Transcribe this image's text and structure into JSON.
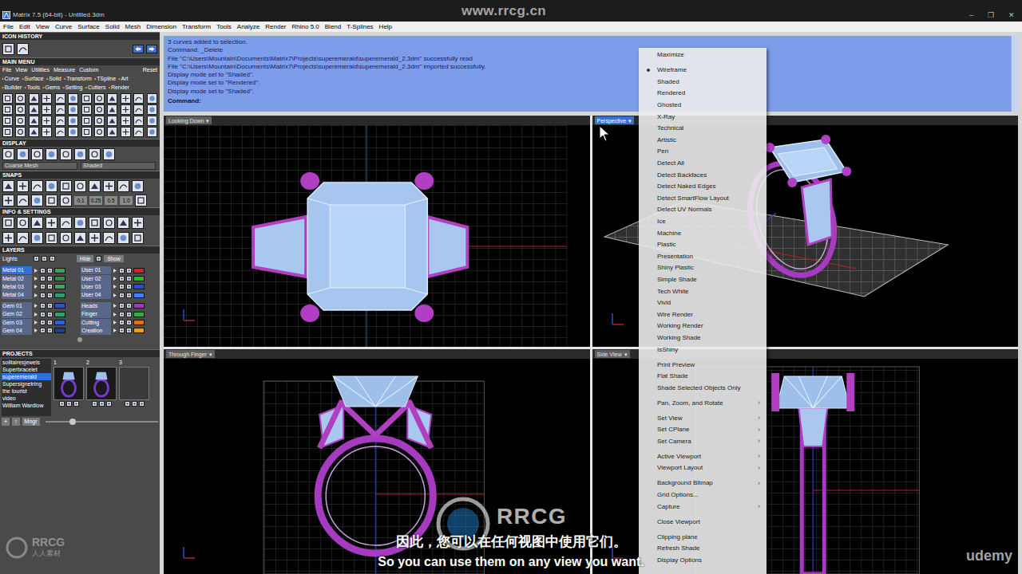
{
  "window": {
    "title": "Matrix 7.5 (64-bit) - Untitled.3dm",
    "controls": [
      "–",
      "❐",
      "✕"
    ]
  },
  "menu_bar": [
    "File",
    "Edit",
    "View",
    "Curve",
    "Surface",
    "Solid",
    "Mesh",
    "Dimension",
    "Transform",
    "Tools",
    "Analyze",
    "Render",
    "Rhino 5.0",
    "Blend",
    "T-Splines",
    "Help"
  ],
  "left_panel": {
    "icon_history": {
      "title": "ICON HISTORY"
    },
    "main_menu": {
      "title": "MAIN MENU",
      "menu": [
        "File",
        "View",
        "Utilities",
        "Measure",
        "Custom"
      ],
      "reset": "Reset",
      "bullet": "•",
      "tabs": [
        {
          "label": "Curve",
          "selected": false
        },
        {
          "label": "Surface",
          "selected": false
        },
        {
          "label": "Solid",
          "selected": false
        },
        {
          "label": "Transform",
          "selected": false
        },
        {
          "label": "TSpline",
          "selected": false
        },
        {
          "label": "Art",
          "selected": false
        },
        {
          "label": "Builder",
          "selected": false
        },
        {
          "label": "Tools",
          "selected": false
        },
        {
          "label": "Gems",
          "selected": false
        },
        {
          "label": "Setting",
          "selected": false
        },
        {
          "label": "Cutters",
          "selected": false
        },
        {
          "label": "Render",
          "selected": false
        }
      ]
    },
    "display": {
      "title": "DISPLAY",
      "mesh": "Coarse Mesh",
      "mode": "Shaded"
    },
    "snaps": {
      "title": "SNAPS",
      "values": [
        "0.1",
        "0.25",
        "0.5",
        "1.0"
      ]
    },
    "info": {
      "title": "INFO & SETTINGS"
    },
    "layers": {
      "title": "LAYERS",
      "lights": "Lights",
      "hide": "Hide",
      "show": "Show",
      "groups": [
        {
          "left": [
            {
              "name": "Metal 01",
              "selected": true,
              "color": "#38a05a"
            },
            {
              "name": "Metal 02",
              "selected": false,
              "color": "#2d8f4e"
            },
            {
              "name": "Metal 03",
              "selected": false,
              "color": "#3aa85f"
            },
            {
              "name": "Metal 04",
              "selected": false,
              "color": "#2f9a7a"
            }
          ],
          "right": [
            {
              "name": "User 01",
              "selected": false,
              "color": "#e02020"
            },
            {
              "name": "User 02",
              "selected": false,
              "color": "#20c020"
            },
            {
              "name": "User 03",
              "selected": false,
              "color": "#2050e0"
            },
            {
              "name": "User 04",
              "selected": false,
              "color": "#4080ff"
            }
          ]
        },
        {
          "left": [
            {
              "name": "Gem 01",
              "selected": false,
              "color": "#3050d0"
            },
            {
              "name": "Gem 02",
              "selected": false,
              "color": "#30a070"
            },
            {
              "name": "Gem 03",
              "selected": false,
              "color": "#3060e0"
            },
            {
              "name": "Gem 04",
              "selected": false,
              "color": "#204080"
            }
          ],
          "right": [
            {
              "name": "Heads",
              "selected": false,
              "color": "#b030c0"
            },
            {
              "name": "Finger",
              "selected": false,
              "color": "#30b040"
            },
            {
              "name": "Cutting",
              "selected": false,
              "color": "#e07020"
            },
            {
              "name": "Creation",
              "selected": false,
              "color": "#e0a020"
            }
          ]
        }
      ]
    },
    "projects": {
      "title": "PROJECTS",
      "items": [
        {
          "label": "solitairesjewels",
          "selected": false
        },
        {
          "label": "Superbracelet",
          "selected": false
        },
        {
          "label": "superemerald",
          "selected": true
        },
        {
          "label": "Supersignetring",
          "selected": false
        },
        {
          "label": "the tourist",
          "selected": false
        },
        {
          "label": "video",
          "selected": false
        },
        {
          "label": "William Wardlow",
          "selected": false
        }
      ],
      "thumbs": [
        {
          "number": "1",
          "has_preview": true
        },
        {
          "number": "2",
          "has_preview": true
        },
        {
          "number": "3",
          "has_preview": false
        }
      ],
      "buttons": [
        "+",
        "↑",
        "Mngr"
      ]
    }
  },
  "command_history": {
    "lines": [
      "3 curves added to selection.",
      "Command: _Delete",
      "File \"C:\\Users\\Mountain\\Documents\\Matrix7\\Projects\\superemerald\\superemerald_2.3dm\" successfully read",
      "File \"C:\\Users\\Mountain\\Documents\\Matrix7\\Projects\\superemerald\\superemerald_2.3dm\" imported successfully.",
      "Display mode set to \"Shaded\".",
      "Display mode set to \"Rendered\".",
      "Display mode set to \"Shaded\"."
    ],
    "prompt": "Command:"
  },
  "viewports": {
    "dropdown_arrow": "▾",
    "items": [
      {
        "label": "Looking Down",
        "active": false
      },
      {
        "label": "Perspective",
        "active": true
      },
      {
        "label": "Through Finger",
        "active": false
      },
      {
        "label": "Side View",
        "active": false
      }
    ]
  },
  "context_menu": {
    "groups": [
      [
        {
          "label": "Maximize",
          "checked": false
        }
      ],
      [
        {
          "label": "Wireframe",
          "checked": true
        },
        {
          "label": "Shaded",
          "checked": false
        },
        {
          "label": "Rendered",
          "checked": false
        },
        {
          "label": "Ghosted",
          "checked": false
        },
        {
          "label": "X-Ray",
          "checked": false
        },
        {
          "label": "Technical",
          "checked": false
        },
        {
          "label": "Artistic",
          "checked": false
        },
        {
          "label": "Pen",
          "checked": false
        },
        {
          "label": "Detect All",
          "checked": false
        },
        {
          "label": "Detect Backfaces",
          "checked": false
        },
        {
          "label": "Detect Naked Edges",
          "checked": false
        },
        {
          "label": "Detect SmartFlow Layout",
          "checked": false
        },
        {
          "label": "Detect UV Normals",
          "checked": false
        },
        {
          "label": "Ice",
          "checked": false
        },
        {
          "label": "Machine",
          "checked": false
        },
        {
          "label": "Plastic",
          "checked": false
        },
        {
          "label": "Presentation",
          "checked": false
        },
        {
          "label": "Shiny Plastic",
          "checked": false
        },
        {
          "label": "Simple Shade",
          "checked": false
        },
        {
          "label": "Tech White",
          "checked": false
        },
        {
          "label": "Vivid",
          "checked": false
        },
        {
          "label": "Wire Render",
          "checked": false
        },
        {
          "label": "Working Render",
          "checked": false
        },
        {
          "label": "Working Shade",
          "checked": false
        },
        {
          "label": "IsShiny",
          "checked": false
        }
      ],
      [
        {
          "label": "Print Preview",
          "checked": false
        },
        {
          "label": "Flat Shade",
          "checked": false
        },
        {
          "label": "Shade Selected Objects Only",
          "checked": false
        }
      ],
      [
        {
          "label": "Pan, Zoom, and Rotate",
          "checked": false,
          "arrow": "›"
        }
      ],
      [
        {
          "label": "Set View",
          "checked": false,
          "arrow": "›"
        },
        {
          "label": "Set CPlane",
          "checked": false,
          "arrow": "›"
        },
        {
          "label": "Set Camera",
          "checked": false,
          "arrow": "›"
        }
      ],
      [
        {
          "label": "Active Viewport",
          "checked": false,
          "arrow": "›"
        },
        {
          "label": "Viewport Layout",
          "checked": false,
          "arrow": "›"
        }
      ],
      [
        {
          "label": "Background Bitmap",
          "checked": false,
          "arrow": "›"
        },
        {
          "label": "Grid Options...",
          "checked": false
        },
        {
          "label": "Capture",
          "checked": false,
          "arrow": "›"
        }
      ],
      [
        {
          "label": "Close Viewport",
          "checked": false
        }
      ],
      [
        {
          "label": "Clipping plane",
          "checked": false
        },
        {
          "label": "Refresh Shade",
          "checked": false
        },
        {
          "label": "Display Options",
          "checked": false
        }
      ]
    ]
  },
  "watermarks": {
    "site": "www.rrcg.cn",
    "logo": "RRCG",
    "corner_logo": "RRCG",
    "corner_text": "人人素材",
    "platform": "udemy"
  },
  "subtitles": {
    "zh": "因此，您可以在任何视图中使用它们。",
    "en": "So you can use them on any view you want."
  }
}
